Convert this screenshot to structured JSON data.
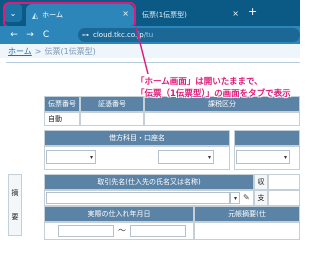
{
  "browser": {
    "tabs": [
      {
        "label": "ホーム",
        "active": true
      },
      {
        "label": "伝票(1伝票型)",
        "active": false
      }
    ],
    "new_tab_symbol": "+",
    "url": "cloud.tkc.co.jp",
    "url_suffix": "/tu",
    "nav": {
      "back": "←",
      "forward": "→",
      "reload": "C"
    },
    "menu_symbol": "⌄",
    "close_symbol": "×",
    "accent_color": "#0b5a86",
    "highlight_color": "#e0197a"
  },
  "breadcrumb": {
    "home": "ホーム",
    "separator": ">",
    "current": "伝票(1伝票型)"
  },
  "callout": {
    "line1": "「ホーム画面」は開いたままで、",
    "line2": "「伝票（1伝票型）」の画面をタブで表示"
  },
  "form": {
    "headers": {
      "voucher_no": "伝票番号",
      "proof_no": "証憑番号",
      "tax_class": "課税区分",
      "debit_account": "借方科目・口座名",
      "partner": "取引先名(仕入先の氏名又は名称)",
      "purchase_date": "実際の仕入れ年月日",
      "original_summary": "元帳摘要(仕"
    },
    "values": {
      "auto": "自動"
    },
    "side_labels": {
      "summary_top": "摘",
      "summary_bottom": "要",
      "right_top": "収",
      "right_bottom": "支"
    },
    "tilde": "～"
  }
}
